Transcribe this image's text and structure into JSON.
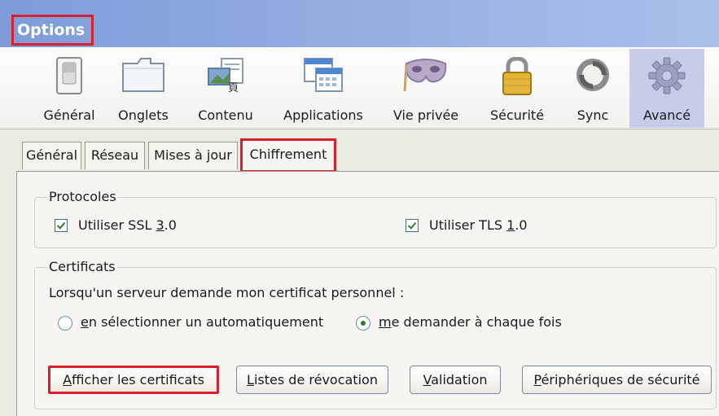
{
  "window": {
    "title": "Options"
  },
  "toolbar": {
    "items": [
      {
        "label": "Général",
        "icon": "general-switch-icon"
      },
      {
        "label": "Onglets",
        "icon": "tabs-window-icon"
      },
      {
        "label": "Contenu",
        "icon": "content-icon"
      },
      {
        "label": "Applications",
        "icon": "applications-icon"
      },
      {
        "label": "Vie privée",
        "icon": "privacy-mask-icon"
      },
      {
        "label": "Sécurité",
        "icon": "padlock-icon"
      },
      {
        "label": "Sync",
        "icon": "sync-icon"
      },
      {
        "label": "Avancé",
        "icon": "gear-icon"
      }
    ],
    "selected": "Avancé"
  },
  "tabs": [
    {
      "label": "Général"
    },
    {
      "label": "Réseau"
    },
    {
      "label": "Mises à jour"
    },
    {
      "label": "Chiffrement"
    }
  ],
  "active_tab": "Chiffrement",
  "protocols": {
    "legend": "Protocoles",
    "ssl": {
      "label_pre": "Utiliser SSL ",
      "label_key": "3",
      "label_post": ".0",
      "checked": true
    },
    "tls": {
      "label_pre": "Utiliser TLS ",
      "label_key": "1",
      "label_post": ".0",
      "checked": true
    }
  },
  "certificates": {
    "legend": "Certificats",
    "description": "Lorsqu'un serveur demande mon certificat personnel :",
    "radio_auto": {
      "label_key": "e",
      "label_rest": "n sélectionner un automatiquement",
      "selected": false
    },
    "radio_ask": {
      "label_key": "m",
      "label_rest": "e demander à chaque fois",
      "selected": true
    }
  },
  "buttons": {
    "show_certs": {
      "label_key": "A",
      "label_rest": "fficher les certificats"
    },
    "revocation": {
      "label_key": "L",
      "label_rest": "istes de révocation"
    },
    "validation": {
      "label_key": "V",
      "label_rest": "alidation"
    },
    "devices": {
      "label_key": "P",
      "label_rest": "ériphériques de sécurité"
    }
  },
  "colors": {
    "highlight": "#d8202c",
    "titlebar": "#7d9cd8",
    "selected_toolbar": "#c7cde8",
    "panel_bg": "#ecebe3",
    "check": "#2e7d32"
  }
}
